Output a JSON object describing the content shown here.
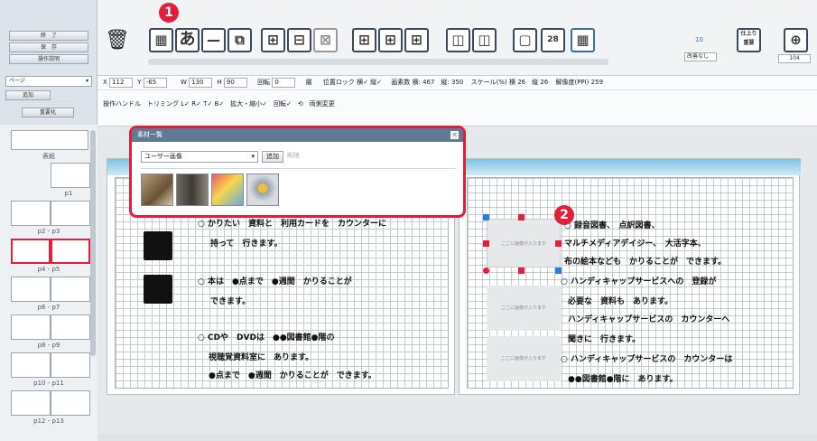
{
  "left_panel": {
    "buttons": [
      "終　了",
      "保　存",
      "操作説明"
    ],
    "page_select": "ページ",
    "page_buttons": [
      "追加",
      "重要化"
    ],
    "cover_label": "表紙",
    "thumbs": [
      "p1",
      "p2 - p3",
      "p4 - p5",
      "p6 - p7",
      "p8 - p9",
      "p10 - p11",
      "p12 - p13"
    ]
  },
  "toolbar": {
    "trash": "🗑",
    "hiragana": "あ",
    "font_size": "10",
    "font_size_sub": "改善なし",
    "shrink_label": "仕上り\n重要",
    "zoom_value": "104"
  },
  "props": {
    "x_label": "X",
    "x_value": "112",
    "y_label": "Y",
    "y_value": "-65",
    "w_label": "W",
    "w_value": "130",
    "h_label": "H",
    "h_value": "90",
    "rotate_label": "回転",
    "rotate_value": "0",
    "layer_label": "層",
    "lock_label": "位置ロック 横✓ 縦✓",
    "pixels_label": "画素数 横: 467　縦: 350",
    "scale_label": "スケール(%) 横 26　縦 26",
    "ppi_label": "解像度(PPI) 259",
    "row2": "操作ハンドル　トリミング L✓ R✓ T✓ B✓　拡大・縮小✓　回転✓　⟲　両側変更"
  },
  "dialog": {
    "title": "素材一覧",
    "close": "×",
    "select": "ユーザー画像",
    "add": "追加",
    "delete": "削除"
  },
  "page_left": {
    "lines": [
      "○ かりたい　資料と　利用カードを　カウンターに",
      "持って　行きます。",
      "○ 本は　●点まで　●週間　かりることが",
      "できます。",
      "○ CDや　DVDは　●●図書館●階の",
      "視聴覚資料室に　あります。",
      "●点まで　●週間　かりることが　できます。"
    ]
  },
  "page_right": {
    "image_placeholder": "ここに画像が入ります",
    "lines": [
      "○ 録音図書、　点訳図書、",
      "マルチメディアデイジー、　大活字本、",
      "布の絵本なども　かりることが　できます。",
      "○ ハンディキャップサービスへの　登録が",
      "必要な　資料も　あります。",
      "ハンディキャップサービスの　カウンターへ",
      "聞きに　行きます。",
      "○ ハンディキャップサービスの　カウンターは",
      "●●図書館●階に　あります。"
    ]
  },
  "markers": {
    "one": "1",
    "two": "2"
  },
  "colors": {
    "accent": "#e0203a",
    "dialog_title": "#5f7a96",
    "band": "#7fc4e4"
  }
}
